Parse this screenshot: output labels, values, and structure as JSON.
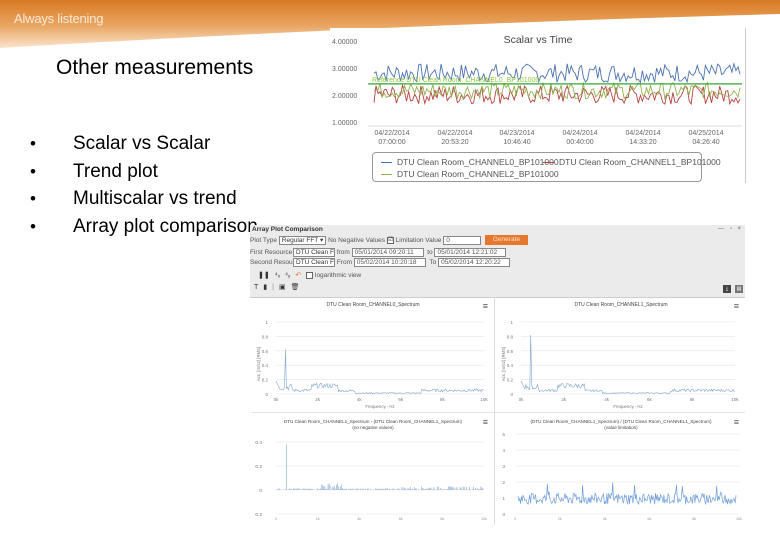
{
  "header": {
    "tagline": "Always listening",
    "brand_color": "#d97a24"
  },
  "slide": {
    "title": "Other measurements",
    "bullets": [
      {
        "label": "Scalar vs Scalar"
      },
      {
        "label": "Trend plot"
      },
      {
        "label": "Multiscalar vs trend"
      },
      {
        "label": "Array plot comparison"
      }
    ],
    "bullet_glyph": "•"
  },
  "scalar_chart": {
    "title": "Scalar vs Time",
    "y_ticks": [
      "4.00000",
      "3.00000",
      "2.00000",
      "1.00000"
    ],
    "x_ticks": [
      {
        "date": "04/22/2014",
        "time": "07:00:00"
      },
      {
        "date": "04/22/2014",
        "time": "20:53:20"
      },
      {
        "date": "04/23/2014",
        "time": "10:46:40"
      },
      {
        "date": "04/24/2014",
        "time": "00:40:00"
      },
      {
        "date": "04/24/2014",
        "time": "14:33:20"
      },
      {
        "date": "04/25/2014",
        "time": "04:26:40"
      }
    ],
    "reference_label": "Reference DTU Clean Room_CHANNEL0_BP101000",
    "reference_value": 2.45,
    "legend": [
      {
        "name": "DTU Clean Room_CHANNEL0_BP101000",
        "color": "#4a72b0"
      },
      {
        "name": "DTU Clean Room_CHANNEL1_BP101000",
        "color": "#b5433f"
      },
      {
        "name": "DTU Clean Room_CHANNEL2_BP101000",
        "color": "#94b051"
      }
    ],
    "reference_color": "#2ea82e"
  },
  "array_window": {
    "title": "Array Plot Comparison",
    "controls": "— ▫ ×",
    "plot_type_label": "Plot Type",
    "plot_type_value": "Regular FFT",
    "no_negative_label": "No Negative Values",
    "no_negative_checked": "☑",
    "limitation_label": "Limitation Value",
    "limitation_value": "0",
    "generate_label": "Generate",
    "first_resource_label": "First Resource",
    "first_resource_value": "DTU Clean F",
    "first_from_label": "from",
    "first_from_value": "05/01/2014 09:20:11",
    "first_to_label": "to",
    "first_to_value": "05/01/2014 12:21:02",
    "second_resource_label": "Second Resource",
    "second_resource_value": "DTU Clean F",
    "second_from_label": "From",
    "second_from_value": "05/02/2014 10:20:18",
    "second_to_label": "To",
    "second_to_value": "05/02/2014 12:20:22",
    "log_label": "logarithmic view",
    "toolbar_icons": [
      "pause-icon",
      "x-axis-icon",
      "y-axis-icon",
      "undo-icon"
    ],
    "toolbar2_icons": [
      "text-icon",
      "marker-icon",
      "save-icon",
      "delete-icon"
    ]
  },
  "sub_charts": [
    {
      "title": "DTU Clean Room_CHANNEL0_Spectrum",
      "y_label": "Acc. [m/s2] [RMS]",
      "x_label": "Frequency - Hz",
      "y_ticks": [
        "1",
        "0.8",
        "0.6",
        "0.4",
        "0.2",
        "0"
      ],
      "x_ticks": [
        "0k",
        "2k",
        "4k",
        "6k",
        "8k",
        "10k"
      ]
    },
    {
      "title": "DTU Clean Room_CHANNEL1_Spectrum",
      "y_label": "Acc. [m/s2] [RMS]",
      "x_label": "Frequency - Hz",
      "y_ticks": [
        "1",
        "0.8",
        "0.6",
        "0.4",
        "0.2",
        "0"
      ],
      "x_ticks": [
        "0k",
        "2k",
        "4k",
        "6k",
        "8k",
        "10k"
      ]
    },
    {
      "title": "DTU Clean Room_CHANNEL1_Spectrum - (DTU Clean Room_CHANNEL1_Spectrum)",
      "subtitle": "(no negative values)",
      "y_ticks": [
        "0.4",
        "0.2",
        "0",
        "0.2"
      ],
      "x_ticks": [
        "0",
        "2k",
        "4k",
        "6k",
        "8k",
        "10k"
      ]
    },
    {
      "title": "(DTU Clean Room_CHANNEL1_Spectrum) / (DTU Clean Room_CHANNEL1_Spectrum)",
      "subtitle": "(value limitation)",
      "y_ticks": [
        "5",
        "4",
        "3",
        "2",
        "1",
        "0"
      ],
      "x_ticks": [
        "0",
        "2k",
        "4k",
        "6k",
        "8k",
        "10k"
      ]
    }
  ],
  "menu_glyph": "≡"
}
